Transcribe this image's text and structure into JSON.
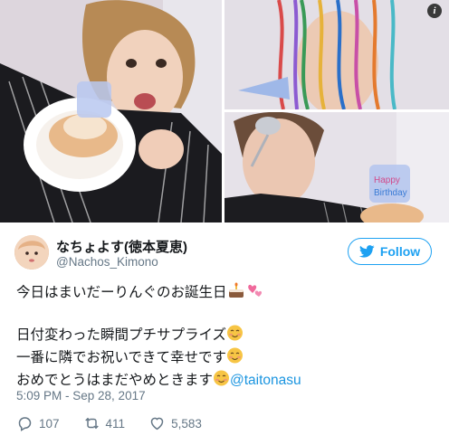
{
  "info_icon": "info-icon",
  "user": {
    "display_name": "なちょよす(徳本夏恵)",
    "handle": "@Nachos_Kimono"
  },
  "follow_button": {
    "label": "Follow",
    "icon": "twitter-bird-icon",
    "color": "#1da1f2"
  },
  "tweet": {
    "line1": "今日はまいだーりんぐのお誕生日",
    "line1_emojis": [
      "cake-icon",
      "two-hearts-icon"
    ],
    "line2": "日付変わった瞬間プチサプライズ",
    "line3": "一番に隣でお祝いできて幸せです",
    "line4": "おめでとうはまだやめときます",
    "mention": "@taitonasu",
    "mention_color": "#1b95e0"
  },
  "timestamp": "5:09 PM - Sep 28, 2017",
  "actions": {
    "reply_count": "107",
    "retweet_count": "411",
    "like_count": "5,583"
  }
}
